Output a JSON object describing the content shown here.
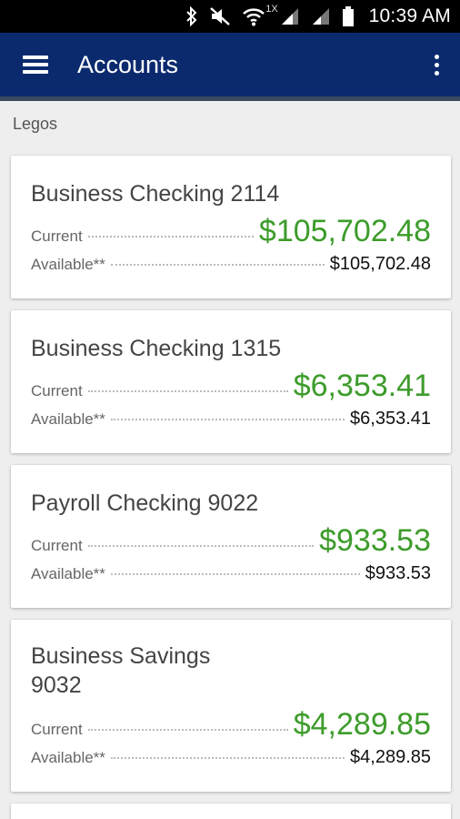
{
  "status_bar": {
    "network_type": "1X",
    "time": "10:39 AM",
    "icons": [
      "bluetooth-icon",
      "vibrate-mute-icon",
      "wifi-icon",
      "cell-signal-icon",
      "cell-signal-icon",
      "battery-icon"
    ]
  },
  "app_bar": {
    "title": "Accounts",
    "menu_icon": "menu-icon",
    "overflow_icon": "more-vert-icon",
    "background_color": "#0b2a6e"
  },
  "group": {
    "name": "Legos"
  },
  "labels": {
    "current": "Current",
    "available": "Available**"
  },
  "accounts": [
    {
      "name": "Business Checking 2114",
      "current": "$105,702.48",
      "available": "$105,702.48"
    },
    {
      "name": "Business Checking 1315",
      "current": "$6,353.41",
      "available": "$6,353.41"
    },
    {
      "name": "Payroll Checking 9022",
      "current": "$933.53",
      "available": "$933.53"
    },
    {
      "name": "Business Savings 9032",
      "current": "$4,289.85",
      "available": "$4,289.85"
    }
  ],
  "colors": {
    "amount_green": "#3d9c2b"
  }
}
